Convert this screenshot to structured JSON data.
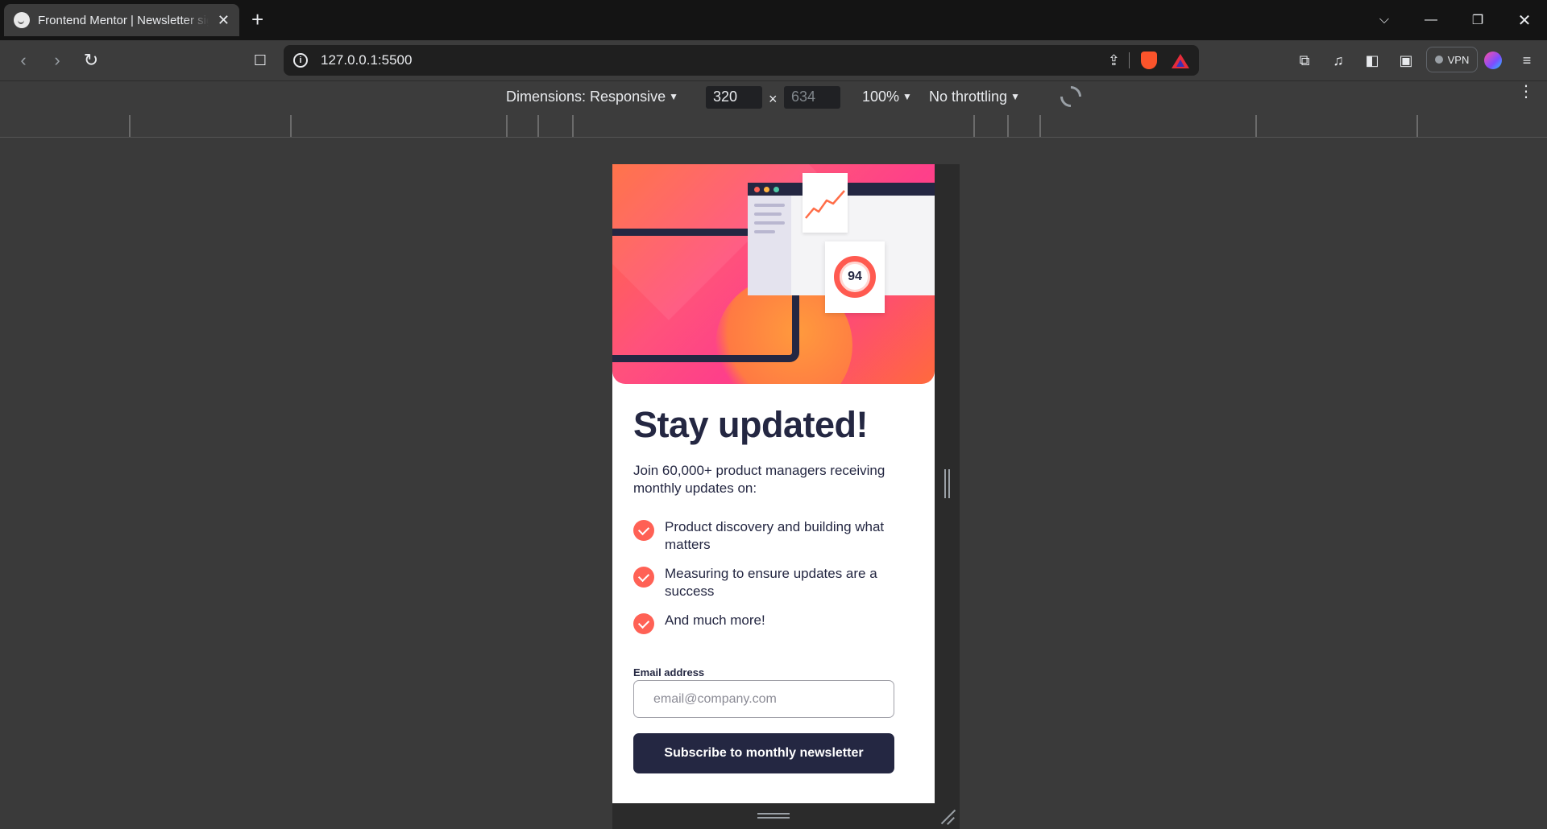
{
  "browser": {
    "tab": {
      "title": "Frontend Mentor | Newsletter sign-up form with success message"
    },
    "address": {
      "url": "127.0.0.1:5500"
    },
    "vpn_label": "VPN"
  },
  "devtools": {
    "dimensions_label": "Dimensions: Responsive",
    "width": "320",
    "height": "634",
    "times": "×",
    "zoom": "100%",
    "throttling": "No throttling"
  },
  "page": {
    "hero": {
      "score": "94",
      "dot_colors": [
        "#ff6155",
        "#ffb23f",
        "#4ec9a6"
      ]
    },
    "title": "Stay updated!",
    "intro": "Join 60,000+ product managers receiving monthly updates on:",
    "features": [
      "Product discovery and building what matters",
      "Measuring to ensure updates are a success",
      "And much more!"
    ],
    "email_label": "Email address",
    "email_placeholder": "email@company.com",
    "email_value": "",
    "subscribe_label": "Subscribe to monthly newsletter",
    "colors": {
      "accent": "#ff6155",
      "dark": "#242742"
    }
  }
}
